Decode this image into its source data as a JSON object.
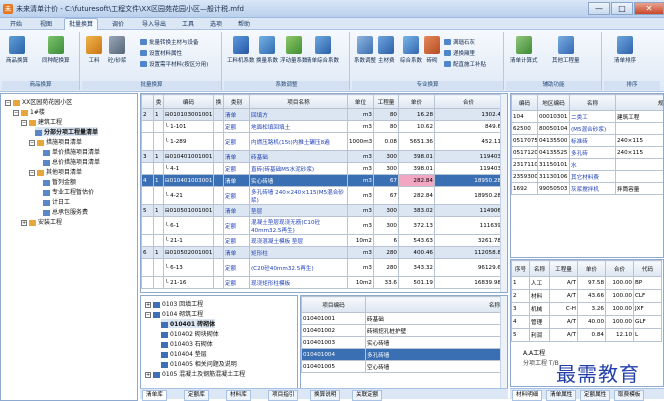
{
  "window": {
    "title": "未来清单计价 - C:\\futuresoft\\工程文件\\XX区园苑花园小区—般计税.mfd",
    "min": "—",
    "max": "□",
    "close": "✕"
  },
  "menu": {
    "tabs": [
      "开始",
      "视图",
      "批量换算",
      "调价",
      "导入导出",
      "工具",
      "选项",
      "帮助"
    ],
    "active": 2
  },
  "ribbon": {
    "groups": [
      {
        "label": "商品换算"
      },
      {
        "label": "批量换算"
      },
      {
        "label": "系数调整"
      },
      {
        "label": "专业换算"
      },
      {
        "label": "辅助功能"
      },
      {
        "label": "排序"
      }
    ],
    "g1": [
      "商品换算",
      "同种配换算"
    ],
    "g2big": [
      "工料",
      "砼/砂浆"
    ],
    "g2small": [
      "批量转换主材与设备",
      "设置材料属性",
      "设置需平材料(按区分用)"
    ],
    "g3": [
      "工料机系数",
      "换量系数",
      "浮动量系数",
      "清单综合系数"
    ],
    "g4": [
      "系数调整",
      "主材费",
      "综合系数",
      "砖砌"
    ],
    "g4small": [
      "满瑙石灰",
      "递换厢里",
      "配直施工补贴"
    ],
    "g5": [
      "清单计算式",
      "其他工程量"
    ],
    "g6": [
      "清单排序"
    ]
  },
  "tree": {
    "items": [
      {
        "text": "XX区园苑花园小区",
        "indent": 0,
        "box": "−"
      },
      {
        "text": "1#楼",
        "indent": 1,
        "box": "−"
      },
      {
        "text": "建筑工程",
        "indent": 2,
        "box": "−"
      },
      {
        "text": "分部分项工程量清单",
        "indent": 3,
        "box": "",
        "bold": true
      },
      {
        "text": "措施项目清单",
        "indent": 3,
        "box": "−"
      },
      {
        "text": "单价措施项目清单",
        "indent": 4,
        "box": ""
      },
      {
        "text": "总价措施项目清单",
        "indent": 4,
        "box": ""
      },
      {
        "text": "其他项目清单",
        "indent": 3,
        "box": "−"
      },
      {
        "text": "暂列金额",
        "indent": 4,
        "box": ""
      },
      {
        "text": "专业工程暂估价",
        "indent": 4,
        "box": ""
      },
      {
        "text": "计日工",
        "indent": 4,
        "box": ""
      },
      {
        "text": "总承包服务费",
        "indent": 4,
        "box": ""
      },
      {
        "text": "安装工程",
        "indent": 2,
        "box": "+"
      }
    ]
  },
  "main": {
    "headers": [
      "",
      "类",
      "编码",
      "换",
      "类别",
      "项目名称",
      "单位",
      "工程量",
      "单价",
      "合价"
    ],
    "rows": [
      {
        "t": "sec",
        "c": [
          "2",
          "1",
          "⊟010103001001",
          "",
          "清单",
          "回填方",
          "m3",
          "80",
          "16.28",
          "1302.4"
        ]
      },
      {
        "t": "",
        "c": [
          "",
          "",
          "└ 1-101",
          "",
          "定额",
          "地面松填回填土",
          "m3",
          "80",
          "10.62",
          "849.6"
        ]
      },
      {
        "t": "",
        "c": [
          "",
          "",
          "└ 1-289",
          "",
          "定额",
          "内燃压路机(15t)内推土碾压8遍",
          "1000m3",
          "0.08",
          "5651.36",
          "452.11"
        ]
      },
      {
        "t": "sec",
        "c": [
          "3",
          "1",
          "⊟010401001001",
          "",
          "清单",
          "砖基础",
          "m3",
          "300",
          "398.01",
          "119403"
        ]
      },
      {
        "t": "",
        "c": [
          "",
          "",
          "└ 4-1",
          "",
          "定额",
          "直砖(砖基础M5水泥砂浆)",
          "m3",
          "300",
          "398.01",
          "119403"
        ]
      },
      {
        "t": "cur",
        "c": [
          "4",
          "1",
          "⊟010401003001",
          "",
          "清单",
          "实心砖墙",
          "m3",
          "67",
          "282.84",
          "18950.28"
        ]
      },
      {
        "t": "",
        "c": [
          "",
          "",
          "└ 4-21",
          "",
          "定额",
          "多孔砖墙 240×240×115(M5混合砂浆)",
          "m3",
          "67",
          "282.84",
          "18950.28"
        ]
      },
      {
        "t": "sec",
        "c": [
          "5",
          "1",
          "⊟010501001001",
          "",
          "清单",
          "垫层",
          "m3",
          "300",
          "383.02",
          "114906"
        ]
      },
      {
        "t": "",
        "c": [
          "",
          "",
          "└ 6-1",
          "",
          "定额",
          "混凝土垫层现浇无筋(C10砼40mm32.5再生)",
          "m3",
          "300",
          "372.13",
          "111639"
        ]
      },
      {
        "t": "",
        "c": [
          "",
          "",
          "└ 21-1",
          "",
          "定额",
          "现浇混凝土模板 垫层",
          "10m2",
          "6",
          "543.63",
          "3261.78"
        ]
      },
      {
        "t": "sec",
        "c": [
          "6",
          "1",
          "⊟010502001001",
          "",
          "清单",
          "矩形柱",
          "m3",
          "280",
          "400.46",
          "112058.8"
        ]
      },
      {
        "t": "",
        "c": [
          "",
          "",
          "└ 6-13",
          "",
          "定额",
          "(C20砼40mm32.5再生)",
          "m3",
          "280",
          "343.32",
          "96129.6"
        ]
      },
      {
        "t": "",
        "c": [
          "",
          "",
          "└ 21-16",
          "",
          "定额",
          "现浇矩形柱模板",
          "10m2",
          "33.6",
          "501.19",
          "16839.98"
        ]
      }
    ]
  },
  "right": {
    "headers": [
      "编码",
      "地区编码",
      "名称",
      "规格"
    ],
    "rows": [
      [
        "104",
        "00010301",
        "二类工",
        "建筑工程"
      ],
      [
        "62500",
        "80050104",
        "(M5混合砂浆)",
        ""
      ],
      [
        "0517075",
        "04135500",
        "标准砖",
        "240×115"
      ],
      [
        "0517120",
        "04135525",
        "多孔砖",
        "240×115"
      ],
      [
        "2317110",
        "31150101",
        "水",
        ""
      ],
      [
        "2359300",
        "31130106",
        "其它材料费",
        ""
      ],
      [
        "1692",
        "99050503",
        "灰浆搅拌机",
        "拌筒容量"
      ]
    ]
  },
  "detail": {
    "headers": [
      "序号",
      "名称",
      "工程量",
      "单价",
      "合价",
      "代码"
    ],
    "rows": [
      [
        "1",
        "人工",
        "A/T",
        "97.58",
        "100.00",
        "BP"
      ],
      [
        "2",
        "材料",
        "A/T",
        "43.66",
        "100.00",
        "CLF"
      ],
      [
        "3",
        "机械",
        "C-H",
        "3.26",
        "100.00",
        "JXF"
      ],
      [
        "4",
        "管理",
        "A/T",
        "40.00",
        "100.00",
        "GLF"
      ],
      [
        "5",
        "利润",
        "A/T",
        "0.84",
        "12.10",
        "L"
      ]
    ],
    "memo": "A,A工程",
    "memo2": "分项工程 T/B"
  },
  "bottomTree": {
    "items": [
      {
        "text": "0103 回填工程",
        "indent": 0,
        "box": "+"
      },
      {
        "text": "0104 砌筑工程",
        "indent": 0,
        "box": "−"
      },
      {
        "text": "010401 砖砌体",
        "indent": 1,
        "box": "",
        "bold": true
      },
      {
        "text": "010402 砌块砌体",
        "indent": 1,
        "box": ""
      },
      {
        "text": "010403 石砌体",
        "indent": 1,
        "box": ""
      },
      {
        "text": "010404 垫层",
        "indent": 1,
        "box": ""
      },
      {
        "text": "010405 相关问题及说明",
        "indent": 1,
        "box": ""
      },
      {
        "text": "0105 混凝土及钢筋混凝土工程",
        "indent": 0,
        "box": "+"
      }
    ]
  },
  "bottomList": {
    "headers": [
      "项目编码",
      "名称"
    ],
    "rows": [
      [
        "010401001",
        "砖基础"
      ],
      [
        "010401002",
        "砖砌挖孔桩护壁"
      ],
      [
        "010401003",
        "实心砖墙"
      ],
      [
        "010401004",
        "多孔砖墙"
      ],
      [
        "010401005",
        "空心砖墙"
      ]
    ],
    "selected": 3
  },
  "bottomTabs": [
    "清单库",
    "定额库",
    "材料库",
    "项目指引",
    "换算说明",
    "关联定额"
  ],
  "rightTabs": [
    "材料明细",
    "清单属性",
    "定额属性",
    "取费模板"
  ],
  "watermark": "最需教育"
}
